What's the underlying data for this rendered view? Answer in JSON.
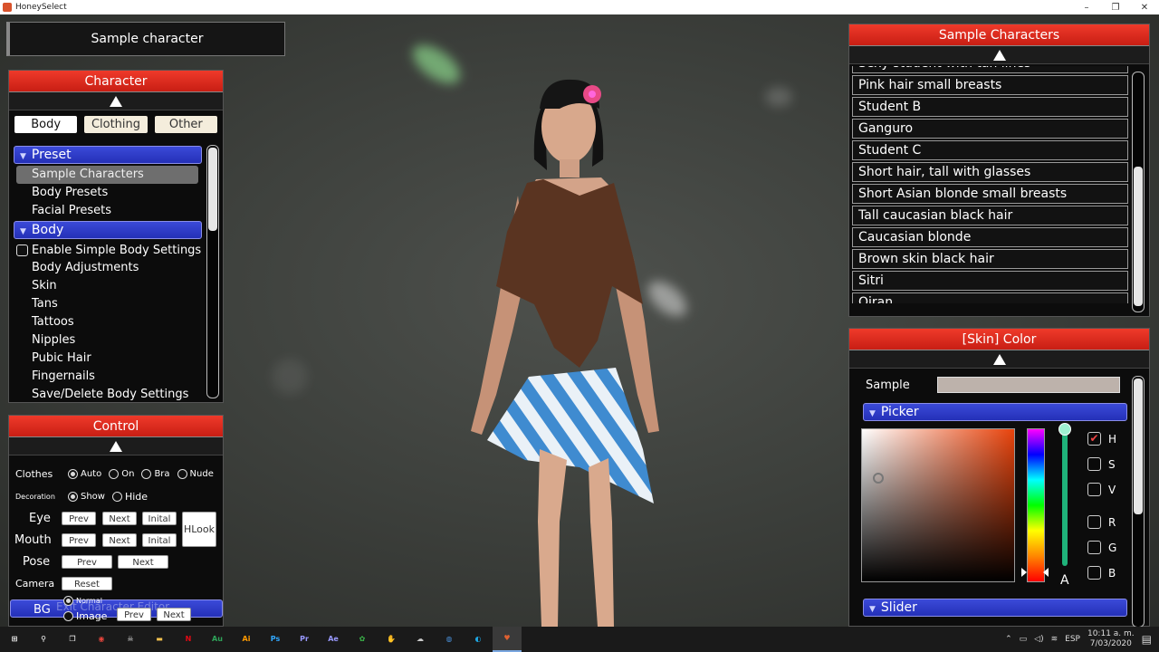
{
  "window": {
    "title": "HoneySelect",
    "minimize": "–",
    "maximize": "❐",
    "close": "✕"
  },
  "sample_title": "Sample character",
  "character_panel": {
    "header": "Character",
    "tabs": [
      {
        "label": "Body"
      },
      {
        "label": "Clothing"
      },
      {
        "label": "Other"
      }
    ],
    "preset_section": "Preset",
    "preset_items": [
      {
        "label": "Sample Characters"
      },
      {
        "label": "Body Presets"
      },
      {
        "label": "Facial Presets"
      }
    ],
    "body_section": "Body",
    "enable_simple": "Enable Simple Body Settings",
    "body_items": [
      {
        "label": "Body Adjustments"
      },
      {
        "label": "Skin"
      },
      {
        "label": "Tans"
      },
      {
        "label": "Tattoos"
      },
      {
        "label": "Nipples"
      },
      {
        "label": "Pubic Hair"
      },
      {
        "label": "Fingernails"
      },
      {
        "label": "Save/Delete Body Settings"
      }
    ]
  },
  "control_panel": {
    "header": "Control",
    "clothes_label": "Clothes",
    "clothes_options": [
      "Auto",
      "On",
      "Bra",
      "Nude"
    ],
    "decoration_label": "Decoration",
    "decoration_options": [
      "Show",
      "Hide"
    ],
    "eye_label": "Eye",
    "mouth_label": "Mouth",
    "pose_label": "Pose",
    "camera_label": "Camera",
    "bg_label": "BG",
    "bg_options": [
      "Normal",
      "Image"
    ],
    "prev": "Prev",
    "next": "Next",
    "inital": "Inital",
    "reset": "Reset",
    "hlook": "HLook",
    "exit_ghost": "Exit Character Editor"
  },
  "sample_characters": {
    "header": "Sample Characters",
    "items": [
      {
        "label": "Sexy student with tan lines"
      },
      {
        "label": "Pink hair small breasts"
      },
      {
        "label": "Student B"
      },
      {
        "label": "Ganguro"
      },
      {
        "label": "Student C"
      },
      {
        "label": "Short hair, tall with glasses"
      },
      {
        "label": "Short Asian blonde small breasts"
      },
      {
        "label": "Tall caucasian black hair"
      },
      {
        "label": "Caucasian blonde"
      },
      {
        "label": "Brown skin black hair"
      },
      {
        "label": "Sitri"
      },
      {
        "label": "Oiran"
      }
    ]
  },
  "skin_color": {
    "header": "[Skin] Color",
    "sample_label": "Sample",
    "sample_color": "#bdb2ab",
    "picker_label": "Picker",
    "hue_color": "#e8430c",
    "channels": [
      {
        "label": "H",
        "checked": true
      },
      {
        "label": "S",
        "checked": false
      },
      {
        "label": "V",
        "checked": false
      },
      {
        "label": "R",
        "checked": false
      },
      {
        "label": "G",
        "checked": false
      },
      {
        "label": "B",
        "checked": false
      }
    ],
    "alpha_label": "A",
    "slider_label": "Slider"
  },
  "taskbar": {
    "lang": "ESP",
    "time": "10:11 a. m.",
    "date": "7/03/2020",
    "apps": [
      {
        "name": "start-icon",
        "glyph": "⊞",
        "color": "#ffffff"
      },
      {
        "name": "search-icon",
        "glyph": "⚲",
        "color": "#ffffff"
      },
      {
        "name": "task-view-icon",
        "glyph": "❐",
        "color": "#ffffff"
      },
      {
        "name": "chrome-icon",
        "glyph": "◉",
        "color": "#e8453c"
      },
      {
        "name": "mask-app-icon",
        "glyph": "☠",
        "color": "#dddddd"
      },
      {
        "name": "folder-icon",
        "glyph": "▬",
        "color": "#f2c14e"
      },
      {
        "name": "netflix-icon",
        "glyph": "N",
        "color": "#e50914"
      },
      {
        "name": "animate-icon",
        "glyph": "Au",
        "color": "#2fa55a"
      },
      {
        "name": "illustrator-icon",
        "glyph": "Ai",
        "color": "#ff9a00"
      },
      {
        "name": "photoshop-icon",
        "glyph": "Ps",
        "color": "#31a8ff"
      },
      {
        "name": "premiere-icon",
        "glyph": "Pr",
        "color": "#9999ff"
      },
      {
        "name": "after-effects-icon",
        "glyph": "Ae",
        "color": "#9999ff"
      },
      {
        "name": "green-app-icon",
        "glyph": "✿",
        "color": "#3bb54a"
      },
      {
        "name": "hand-app-icon",
        "glyph": "✋",
        "color": "#f0a040"
      },
      {
        "name": "steam-like-icon",
        "glyph": "☁",
        "color": "#cccccc"
      },
      {
        "name": "blue-app-icon",
        "glyph": "◍",
        "color": "#4a90d9"
      },
      {
        "name": "edge-icon",
        "glyph": "◐",
        "color": "#1fa5e0"
      },
      {
        "name": "honeyselect-icon",
        "glyph": "♥",
        "color": "#e06030"
      }
    ]
  }
}
